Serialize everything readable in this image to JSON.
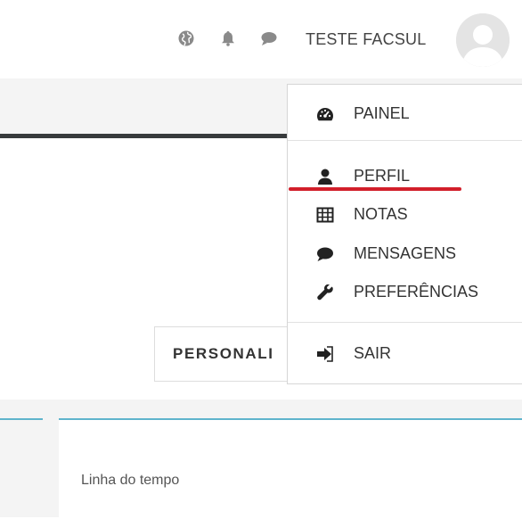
{
  "navbar": {
    "icons": [
      "globe-icon",
      "bell-icon",
      "chat-icon"
    ],
    "user_name": "TESTE FACSUL",
    "avatar": "default-user-avatar"
  },
  "user_menu": {
    "items": [
      {
        "label": "PAINEL",
        "icon": "dashboard-icon"
      },
      {
        "label": "PERFIL",
        "icon": "user-icon"
      },
      {
        "label": "NOTAS",
        "icon": "grid-table-icon"
      },
      {
        "label": "MENSAGENS",
        "icon": "chat-icon"
      },
      {
        "label": "PREFERÊNCIAS",
        "icon": "wrench-icon"
      },
      {
        "label": "SAIR",
        "icon": "sign-out-icon"
      }
    ],
    "highlight_color": "#d21f2b"
  },
  "page": {
    "customize_button": "PERSONALI",
    "timeline_title": "Linha do tempo"
  },
  "colors": {
    "accent": "#5fb4cc",
    "header_border": "#373a3c"
  }
}
